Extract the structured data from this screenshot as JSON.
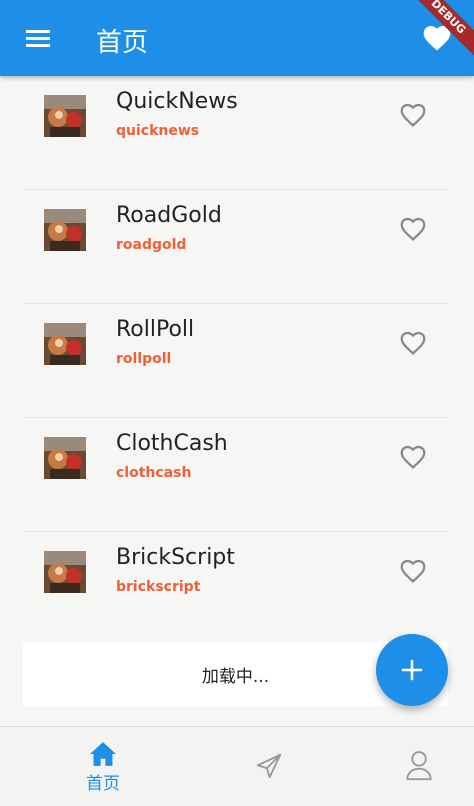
{
  "appbar": {
    "title": "首页",
    "debug_label": "DEBUG"
  },
  "items": [
    {
      "name": "QuickNews",
      "slug": "quicknews"
    },
    {
      "name": "RoadGold",
      "slug": "roadgold"
    },
    {
      "name": "RollPoll",
      "slug": "rollpoll"
    },
    {
      "name": "ClothCash",
      "slug": "clothcash"
    },
    {
      "name": "BrickScript",
      "slug": "brickscript"
    }
  ],
  "loading": {
    "text": "加载中..."
  },
  "bottom_nav": {
    "home_label": "首页"
  },
  "colors": {
    "primary": "#1e8fe9",
    "accent_text": "#f06038",
    "background": "#f6f6f4"
  },
  "icons": {
    "menu": "menu-icon",
    "favorite": "heart-filled-icon",
    "like": "heart-outline-icon",
    "add": "plus-icon",
    "home": "home-icon",
    "send": "send-icon",
    "profile": "person-icon"
  }
}
